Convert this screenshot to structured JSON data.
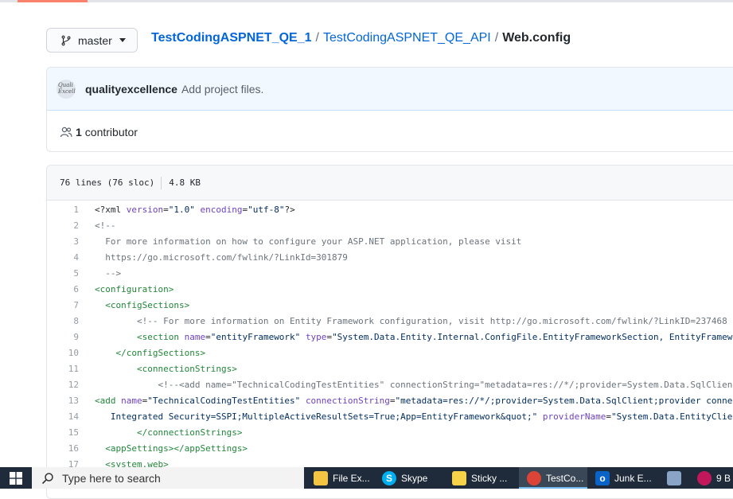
{
  "branch": {
    "label": "master"
  },
  "breadcrumb": {
    "repo": "TestCodingASPNET_QE_1",
    "sep1": "/",
    "folder": "TestCodingASPNET_QE_API",
    "sep2": "/",
    "file": "Web.config"
  },
  "commit": {
    "author": "qualityexcellence",
    "message": "Add project files.",
    "avatar_text": "Quali Excelle"
  },
  "contributors": {
    "count": "1",
    "label": "contributor"
  },
  "file_info": {
    "lines": "76 lines (76 sloc)",
    "size": "4.8 KB"
  },
  "code_lines": [
    {
      "n": "1",
      "tokens": [
        {
          "c": "pl",
          "t": "<?xml "
        },
        {
          "c": "at",
          "t": "version"
        },
        {
          "c": "pl",
          "t": "="
        },
        {
          "c": "st",
          "t": "\"1.0\""
        },
        {
          "c": "pl",
          "t": " "
        },
        {
          "c": "at",
          "t": "encoding"
        },
        {
          "c": "pl",
          "t": "="
        },
        {
          "c": "st",
          "t": "\"utf-8\""
        },
        {
          "c": "pl",
          "t": "?>"
        }
      ]
    },
    {
      "n": "2",
      "tokens": [
        {
          "c": "cm",
          "t": "<!--"
        }
      ]
    },
    {
      "n": "3",
      "tokens": [
        {
          "c": "cm",
          "t": "  For more information on how to configure your ASP.NET application, please visit"
        }
      ]
    },
    {
      "n": "4",
      "tokens": [
        {
          "c": "cm",
          "t": "  https://go.microsoft.com/fwlink/?LinkId=301879"
        }
      ]
    },
    {
      "n": "5",
      "tokens": [
        {
          "c": "cm",
          "t": "  -->"
        }
      ]
    },
    {
      "n": "6",
      "tokens": [
        {
          "c": "tg",
          "t": "<configuration>"
        }
      ]
    },
    {
      "n": "7",
      "tokens": [
        {
          "c": "pl",
          "t": "  "
        },
        {
          "c": "tg",
          "t": "<configSections>"
        }
      ]
    },
    {
      "n": "8",
      "tokens": [
        {
          "c": "cm",
          "t": "        <!-- For more information on Entity Framework configuration, visit http://go.microsoft.com/fwlink/?LinkID=237468 -->"
        }
      ]
    },
    {
      "n": "9",
      "tokens": [
        {
          "c": "pl",
          "t": "        "
        },
        {
          "c": "tg",
          "t": "<section "
        },
        {
          "c": "at",
          "t": "name"
        },
        {
          "c": "pl",
          "t": "="
        },
        {
          "c": "st",
          "t": "\"entityFramework\""
        },
        {
          "c": "pl",
          "t": " "
        },
        {
          "c": "at",
          "t": "type"
        },
        {
          "c": "pl",
          "t": "="
        },
        {
          "c": "st",
          "t": "\"System.Data.Entity.Internal.ConfigFile.EntityFrameworkSection, EntityFramework, Version=6.0.0.0\""
        }
      ]
    },
    {
      "n": "10",
      "tokens": [
        {
          "c": "pl",
          "t": "    "
        },
        {
          "c": "tg",
          "t": "</configSections>"
        }
      ]
    },
    {
      "n": "11",
      "tokens": [
        {
          "c": "pl",
          "t": "        "
        },
        {
          "c": "tg",
          "t": "<connectionStrings>"
        }
      ]
    },
    {
      "n": "12",
      "tokens": [
        {
          "c": "cm",
          "t": "            <!--<add name=\"TechnicalCodingTestEntities\" connectionString=\"metadata=res://*/;provider=System.Data.SqlClient;provider"
        }
      ]
    },
    {
      "n": "13",
      "tokens": [
        {
          "c": "tg",
          "t": "<add "
        },
        {
          "c": "at",
          "t": "name"
        },
        {
          "c": "pl",
          "t": "="
        },
        {
          "c": "st",
          "t": "\"TechnicalCodingTestEntities\""
        },
        {
          "c": "pl",
          "t": " "
        },
        {
          "c": "at",
          "t": "connectionString"
        },
        {
          "c": "pl",
          "t": "="
        },
        {
          "c": "st",
          "t": "\"metadata=res://*/;provider=System.Data.SqlClient;provider connection string="
        }
      ]
    },
    {
      "n": "14",
      "tokens": [
        {
          "c": "st",
          "t": "   Integrated Security=SSPI;MultipleActiveResultSets=True;App=EntityFramework&quot;\""
        },
        {
          "c": "pl",
          "t": " "
        },
        {
          "c": "at",
          "t": "providerName"
        },
        {
          "c": "pl",
          "t": "="
        },
        {
          "c": "st",
          "t": "\"System.Data.EntityClient\""
        }
      ]
    },
    {
      "n": "15",
      "tokens": [
        {
          "c": "pl",
          "t": "        "
        },
        {
          "c": "tg",
          "t": "</connectionStrings>"
        }
      ]
    },
    {
      "n": "16",
      "tokens": [
        {
          "c": "pl",
          "t": "  "
        },
        {
          "c": "tg",
          "t": "<appSettings></appSettings>"
        }
      ]
    },
    {
      "n": "17",
      "tokens": [
        {
          "c": "pl",
          "t": "  "
        },
        {
          "c": "tg",
          "t": "<system.web>"
        }
      ]
    }
  ],
  "taskbar": {
    "search_placeholder": "Type here to search",
    "items": [
      {
        "label": "File Ex...",
        "icon": "file-explorer-icon",
        "color": "#f4c542"
      },
      {
        "label": "Skype",
        "icon": "skype-icon",
        "color": "#00aff0"
      },
      {
        "label": "Sticky ...",
        "icon": "sticky-notes-icon",
        "color": "#f7d34a"
      },
      {
        "label": "TestCo...",
        "icon": "chrome-icon",
        "color": "#db4437"
      },
      {
        "label": "Junk E...",
        "icon": "outlook-icon",
        "color": "#0a64c8"
      },
      {
        "label": "",
        "icon": "photos-icon",
        "color": "#8aa4c8"
      },
      {
        "label": "9 B",
        "icon": "chrome-profile-icon",
        "color": "#c2185b"
      }
    ]
  }
}
